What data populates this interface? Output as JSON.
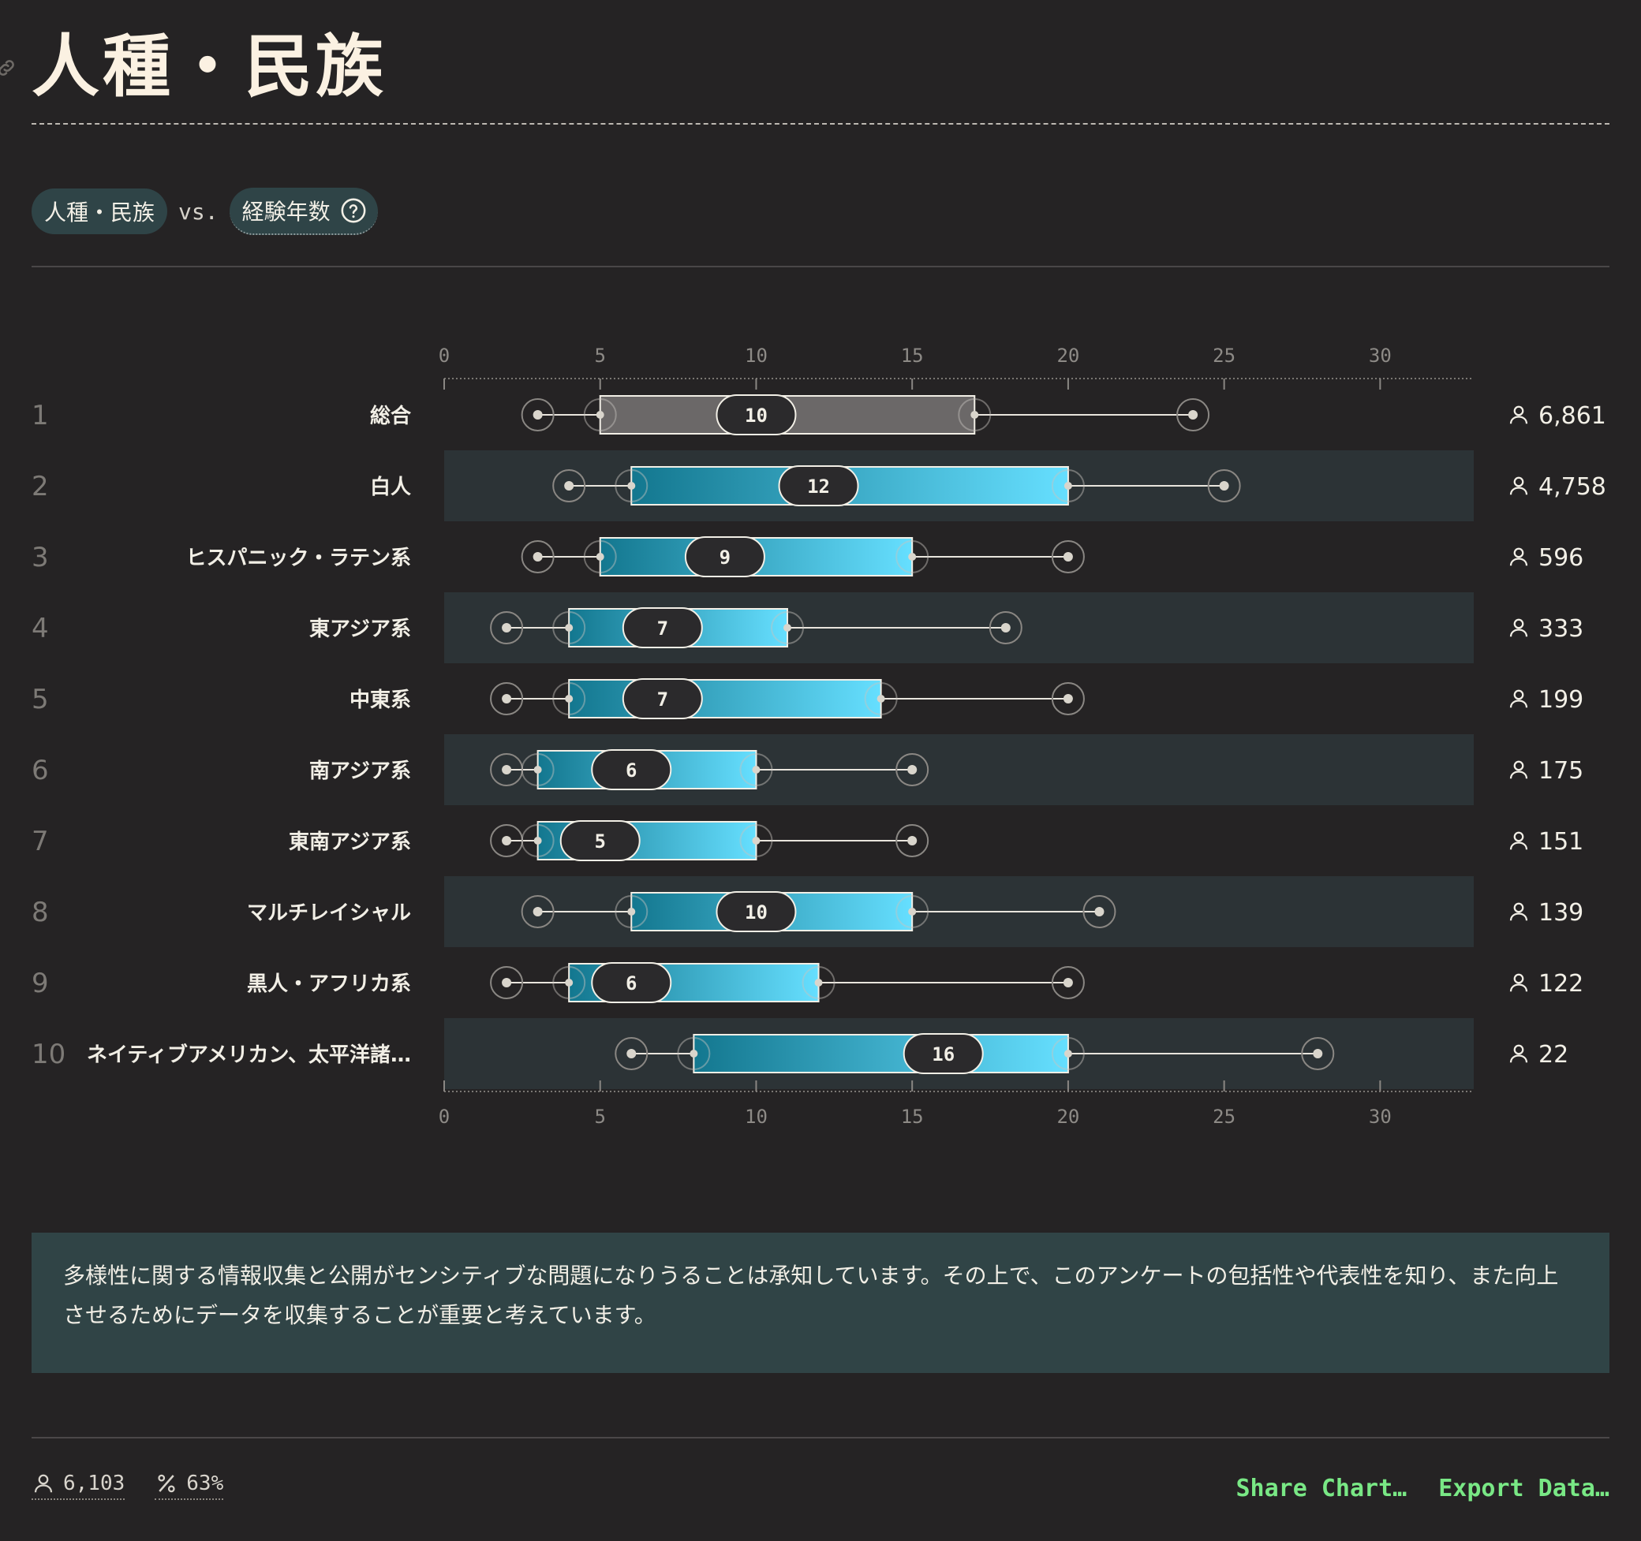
{
  "title": "人種・民族",
  "selector": {
    "primary": "人種・民族",
    "vs": "vs.",
    "secondary": "経験年数"
  },
  "colors": {
    "background": "#252324",
    "row_band": "#2c3336",
    "box_gradient_start": "#13778f",
    "box_gradient_end": "#66dfff",
    "overall_box": "#6b6868",
    "note_background": "#304446",
    "link_green": "#79e885"
  },
  "chart_data": {
    "type": "boxplot",
    "xlim": [
      0,
      33
    ],
    "ticks": [
      0,
      5,
      10,
      15,
      20,
      25,
      30
    ],
    "grid": false,
    "rows": [
      {
        "rank": "1",
        "label": "総合",
        "min": 3,
        "q1": 5,
        "median": 10,
        "q3": 17,
        "max": 24,
        "count": "6,861",
        "overall": true
      },
      {
        "rank": "2",
        "label": "白人",
        "min": 4,
        "q1": 6,
        "median": 12,
        "q3": 20,
        "max": 25,
        "count": "4,758"
      },
      {
        "rank": "3",
        "label": "ヒスパニック・ラテン系",
        "min": 3,
        "q1": 5,
        "median": 9,
        "q3": 15,
        "max": 20,
        "count": "596"
      },
      {
        "rank": "4",
        "label": "東アジア系",
        "min": 2,
        "q1": 4,
        "median": 7,
        "q3": 11,
        "max": 18,
        "count": "333"
      },
      {
        "rank": "5",
        "label": "中東系",
        "min": 2,
        "q1": 4,
        "median": 7,
        "q3": 14,
        "max": 20,
        "count": "199"
      },
      {
        "rank": "6",
        "label": "南アジア系",
        "min": 2,
        "q1": 3,
        "median": 6,
        "q3": 10,
        "max": 15,
        "count": "175"
      },
      {
        "rank": "7",
        "label": "東南アジア系",
        "min": 2,
        "q1": 3,
        "median": 5,
        "q3": 10,
        "max": 15,
        "count": "151"
      },
      {
        "rank": "8",
        "label": "マルチレイシャル",
        "min": 3,
        "q1": 6,
        "median": 10,
        "q3": 15,
        "max": 21,
        "count": "139"
      },
      {
        "rank": "9",
        "label": "黒人・アフリカ系",
        "min": 2,
        "q1": 4,
        "median": 6,
        "q3": 12,
        "max": 20,
        "count": "122"
      },
      {
        "rank": "10",
        "label": "ネイティブアメリカン、太平洋諸…",
        "min": 6,
        "q1": 8,
        "median": 16,
        "q3": 20,
        "max": 28,
        "count": "22"
      }
    ]
  },
  "note": "多様性に関する情報収集と公開がセンシティブな問題になりうることは承知しています。その上で、このアンケートの包括性や代表性を知り、また向上させるためにデータを収集することが重要と考えています。",
  "footer": {
    "respondents": "6,103",
    "percent": "63%",
    "share_label": "Share Chart…",
    "export_label": "Export Data…"
  },
  "icons": [
    "link-icon",
    "help-circle-icon",
    "person-icon",
    "percent-icon"
  ]
}
